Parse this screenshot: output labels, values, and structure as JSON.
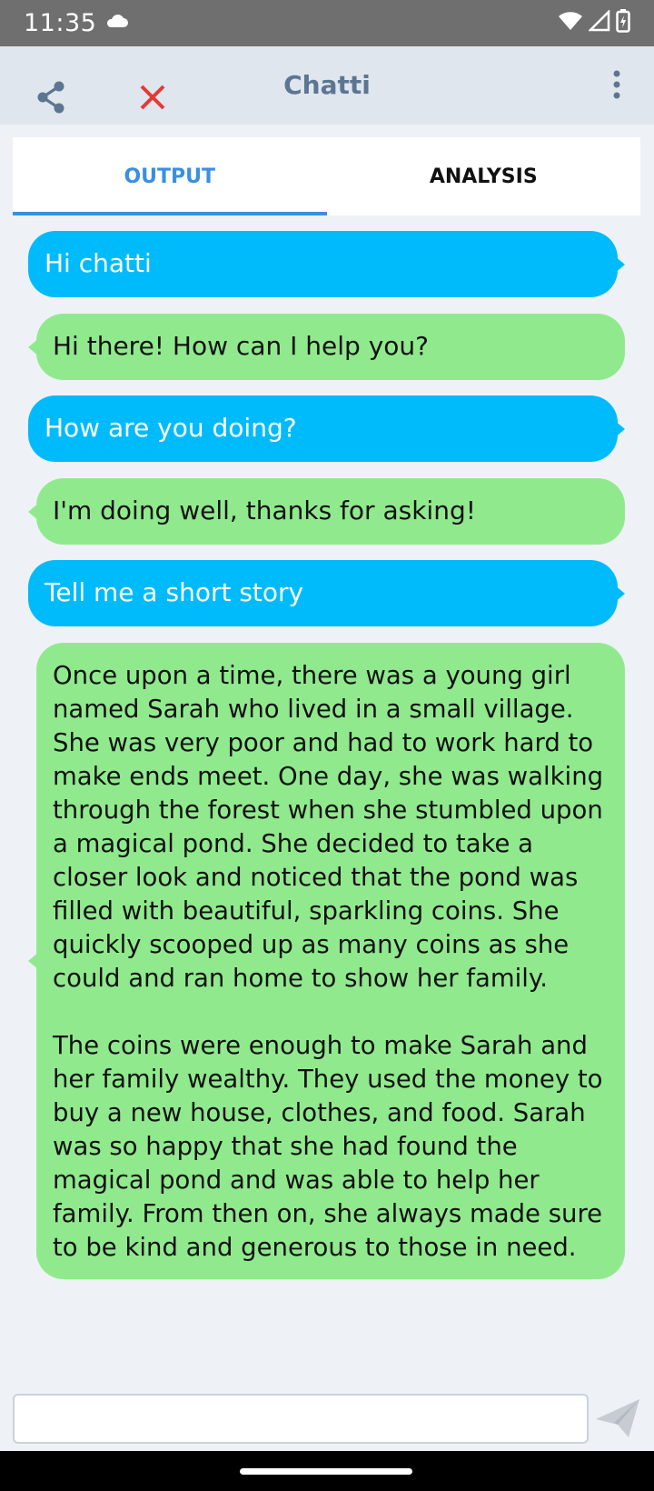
{
  "status_bar": {
    "time": "11:35",
    "icons": [
      "cloud-icon",
      "wifi-icon",
      "signal-icon",
      "battery-icon"
    ]
  },
  "toolbar": {
    "title": "Chatti",
    "icons": {
      "share": "share-icon",
      "close": "close-icon",
      "more": "more-vert-icon"
    },
    "close_color": "#e53935"
  },
  "tabs": [
    {
      "label": "OUTPUT",
      "active": true
    },
    {
      "label": "ANALYSIS",
      "active": false
    }
  ],
  "colors": {
    "user_bubble": "#00bbfb",
    "bot_bubble": "#90ea8d",
    "accent": "#3b8fe0",
    "background": "#eef2f6"
  },
  "messages": [
    {
      "sender": "user",
      "text": "Hi chatti"
    },
    {
      "sender": "bot",
      "text": "Hi there! How can I help you?"
    },
    {
      "sender": "user",
      "text": "How are you doing?"
    },
    {
      "sender": "bot",
      "text": "I'm doing well, thanks for asking!"
    },
    {
      "sender": "user",
      "text": "Tell me a short story"
    },
    {
      "sender": "bot",
      "text": "Once upon a time, there was a young girl\nnamed Sarah who lived in a small village.\nShe was very poor and had to work hard to\nmake ends meet. One day, she was walking\nthrough the forest when she stumbled upon\na magical pond. She decided to take a\ncloser look and noticed that the pond was\nfilled with beautiful, sparkling coins. She\nquickly scooped up as many coins as she\ncould and ran home to show her family.\n\nThe coins were enough to make Sarah and\nher family wealthy. They used the money to\nbuy a new house, clothes, and food. Sarah\nwas so happy that she had found the\nmagical pond and was able to help her\nfamily. From then on, she always made sure\nto be kind and generous to those in need."
    }
  ],
  "composer": {
    "placeholder": "",
    "value": "",
    "send_icon": "send-icon"
  }
}
